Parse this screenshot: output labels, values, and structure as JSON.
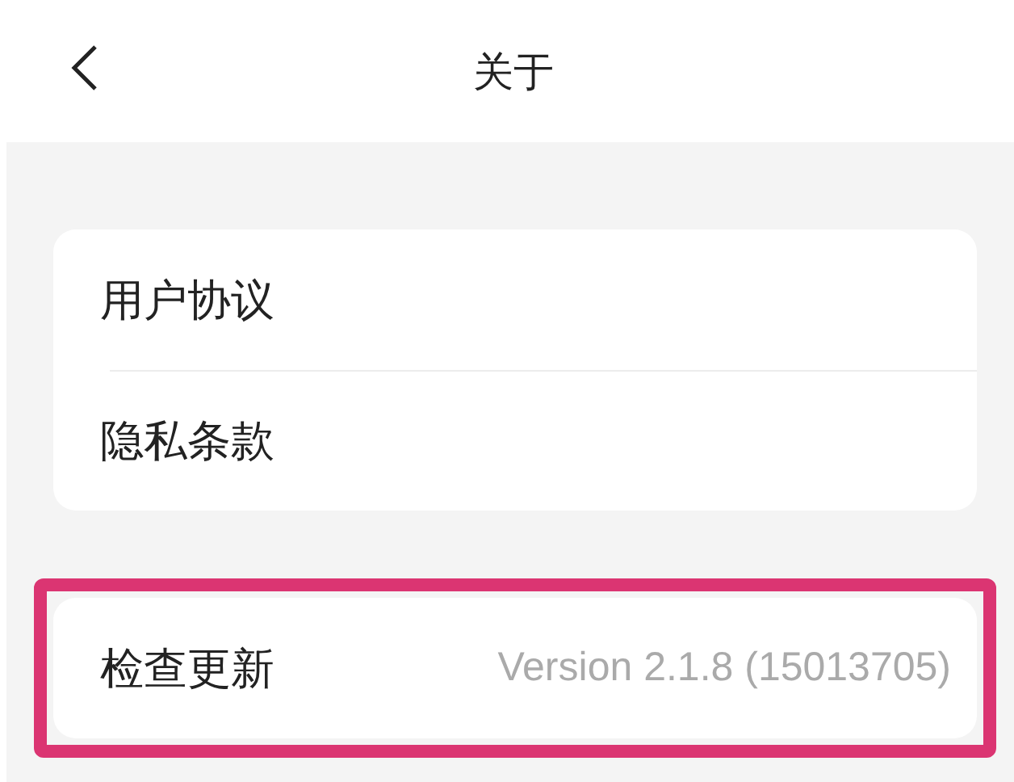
{
  "header": {
    "title": "关于"
  },
  "groups": [
    {
      "highlighted": false,
      "items": [
        {
          "label": "用户协议"
        },
        {
          "label": "隐私条款"
        }
      ]
    },
    {
      "highlighted": true,
      "items": [
        {
          "label": "检查更新",
          "value": "Version 2.1.8 (15013705)"
        }
      ]
    }
  ]
}
